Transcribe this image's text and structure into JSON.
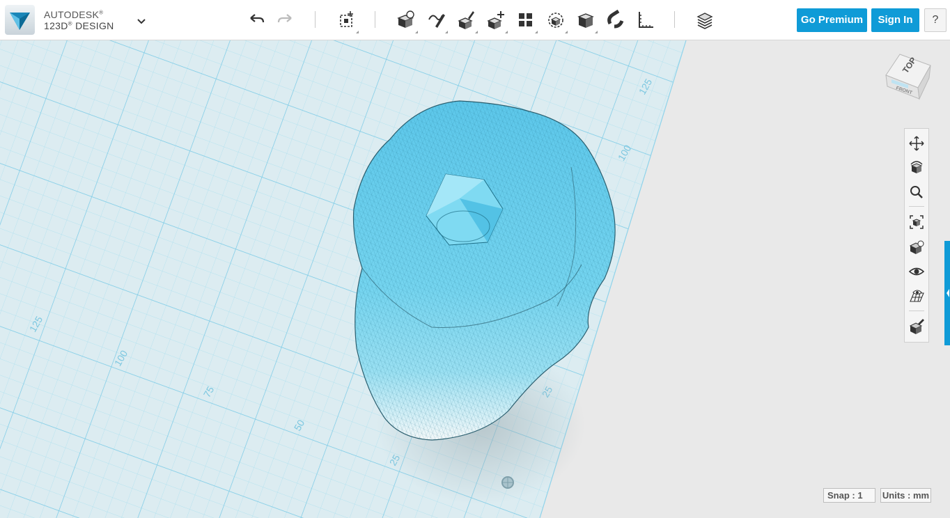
{
  "app": {
    "brand_line1": "AUTODESK",
    "brand_line2": "123D",
    "brand_line2b": "DESIGN",
    "brand_mark": "®"
  },
  "toolbar": {
    "icons": [
      "undo-icon",
      "redo-icon",
      "transform-icon",
      "primitives-icon",
      "sketch-icon",
      "construct-icon",
      "modify-icon",
      "pattern-icon",
      "grouping-icon",
      "combine-icon",
      "snap-icon",
      "measure-icon",
      "material-icon"
    ],
    "go_premium_label": "Go Premium",
    "sign_in_label": "Sign In",
    "help_label": "?"
  },
  "viewcube": {
    "face_top": "TOP",
    "face_front": "FRONT"
  },
  "navigation": [
    "pan",
    "orbit",
    "zoom",
    "fit",
    "views",
    "visibility",
    "grid",
    "material"
  ],
  "grid": {
    "labels_left": [
      "125",
      "100",
      "75",
      "50",
      "25"
    ],
    "labels_right": [
      "125",
      "100",
      "25"
    ]
  },
  "status": {
    "snap": "Snap : 1",
    "units": "Units : mm"
  },
  "colors": {
    "accent": "#0f9bd7",
    "model": "#6fd0ee",
    "grid_line": "#8fd3ea"
  }
}
